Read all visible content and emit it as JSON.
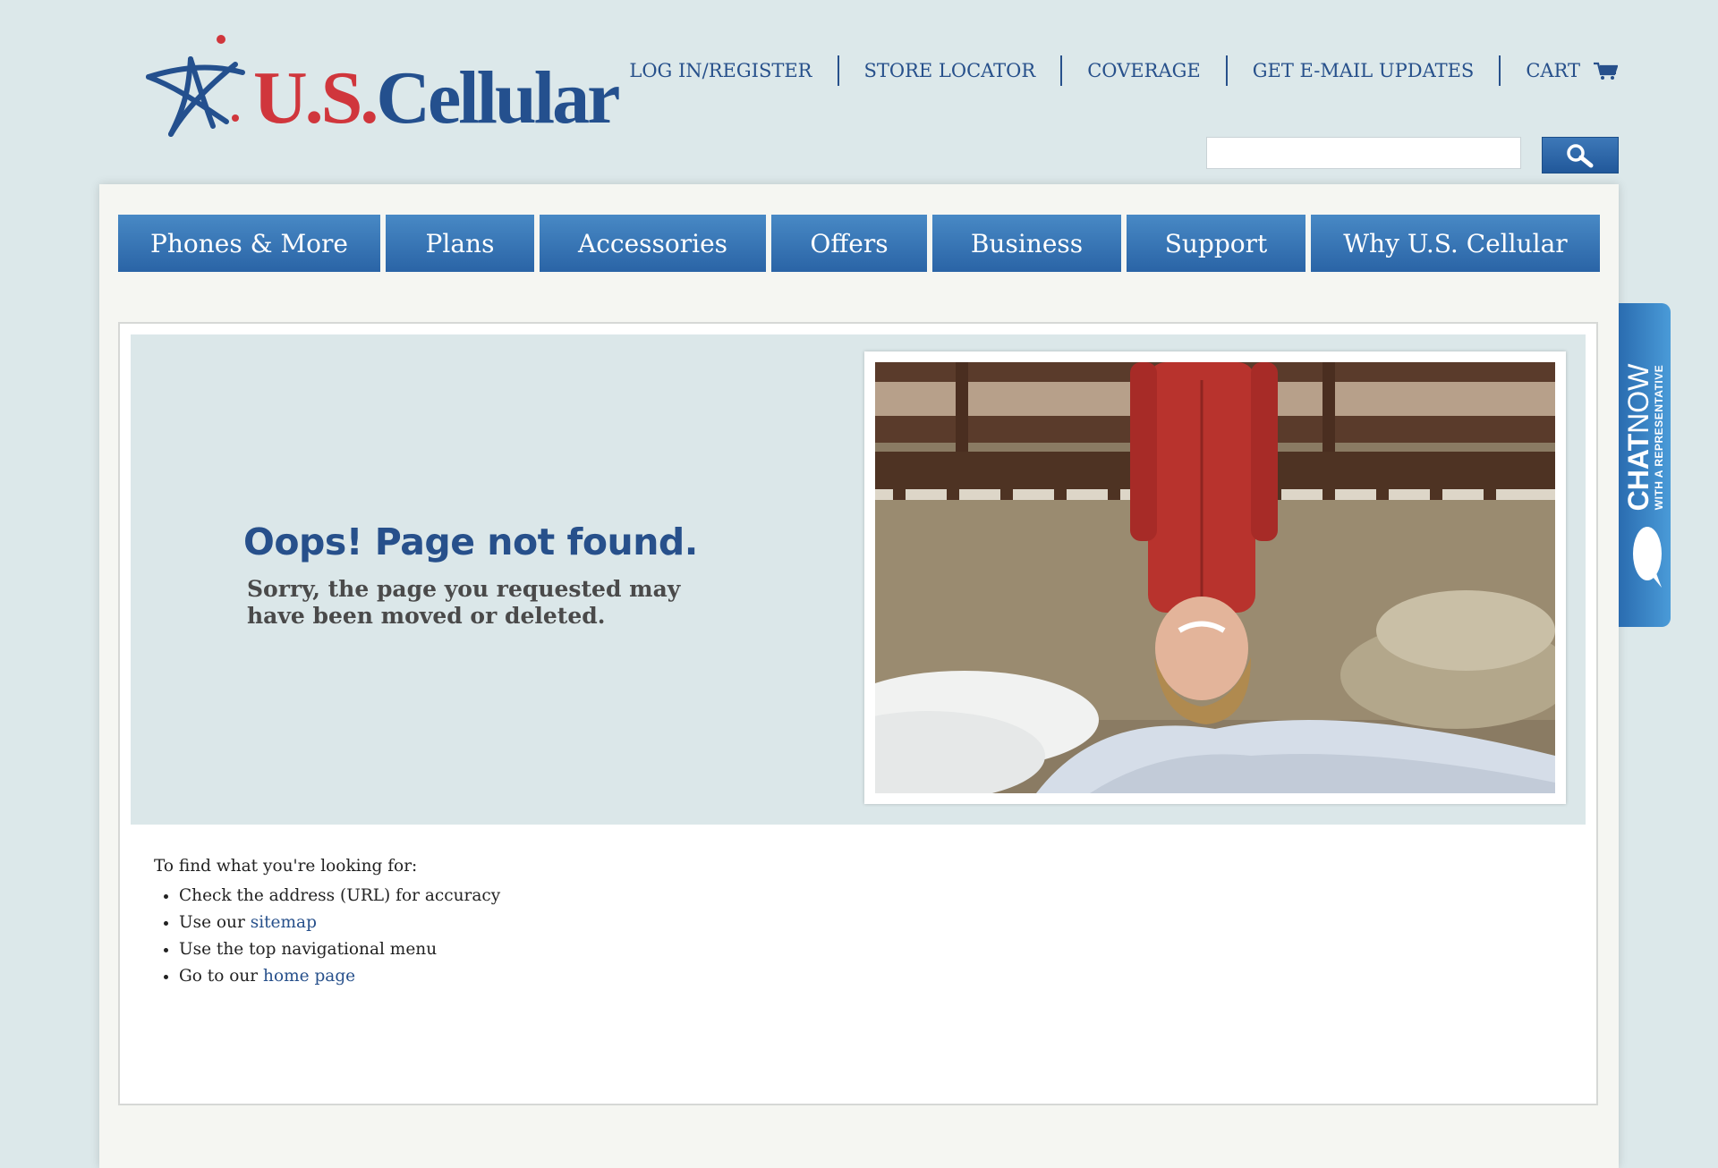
{
  "logo": {
    "brand_us": "U.S.",
    "brand_cellular": "Cellular"
  },
  "top_links": [
    "LOG IN/REGISTER",
    "STORE LOCATOR",
    "COVERAGE",
    "GET E-MAIL UPDATES",
    "CART"
  ],
  "search": {
    "placeholder": ""
  },
  "nav": [
    "Phones & More",
    "Plans",
    "Accessories",
    "Offers",
    "Business",
    "Support",
    "Why U.S. Cellular"
  ],
  "hero": {
    "title": "Oops! Page not found.",
    "subtitle": "Sorry, the page you requested may have been moved or deleted."
  },
  "help": {
    "intro": "To find what you're looking for:",
    "item1": "Check the address (URL) for accuracy",
    "item2_prefix": "Use our ",
    "item2_link": "sitemap",
    "item3": "Use the top navigational menu",
    "item4_prefix": "Go to our ",
    "item4_link": "home page"
  },
  "chat": {
    "chat": "CHAT",
    "now": "NOW",
    "rep": "WITH A REPRESENTATIVE"
  },
  "colors": {
    "brand_blue": "#27508b",
    "brand_red": "#d0363c",
    "page_bg": "#dce8ea"
  }
}
